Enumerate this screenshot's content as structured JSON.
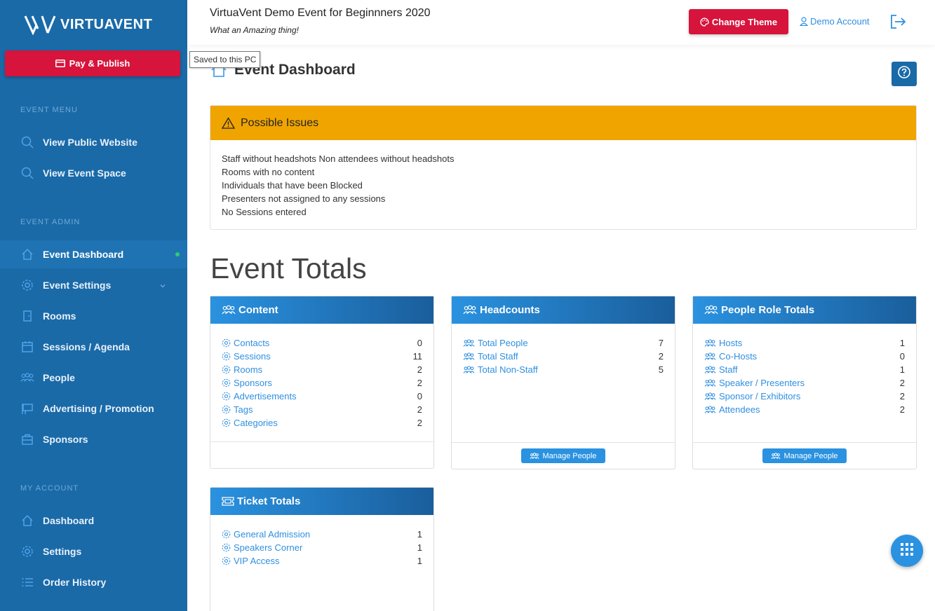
{
  "brand": {
    "name": "VIRTUAVENT"
  },
  "sidebar": {
    "pay_publish_label": "Pay & Publish",
    "sections": {
      "event_menu": "EVENT MENU",
      "event_admin": "EVENT ADMIN",
      "my_account": "MY ACCOUNT"
    },
    "event_menu_items": [
      {
        "label": "View Public Website",
        "icon": "search-icon"
      },
      {
        "label": "View Event Space",
        "icon": "search-icon"
      }
    ],
    "event_admin_items": [
      {
        "label": "Event Dashboard",
        "icon": "home-icon",
        "active": true
      },
      {
        "label": "Event Settings",
        "icon": "gear-icon"
      },
      {
        "label": "Rooms",
        "icon": "door-icon"
      },
      {
        "label": "Sessions / Agenda",
        "icon": "calendar-icon"
      },
      {
        "label": "People",
        "icon": "people-icon"
      },
      {
        "label": "Advertising / Promotion",
        "icon": "billboard-icon"
      },
      {
        "label": "Sponsors",
        "icon": "briefcase-icon"
      }
    ],
    "my_account_items": [
      {
        "label": "Dashboard",
        "icon": "home-icon"
      },
      {
        "label": "Settings",
        "icon": "gear-icon"
      },
      {
        "label": "Order History",
        "icon": "list-icon"
      }
    ]
  },
  "topbar": {
    "event_title": "VirtuaVent Demo Event for Beginnners 2020",
    "tagline": "What an Amazing thing!",
    "change_theme_label": "Change Theme",
    "account_label": "Demo Account"
  },
  "tooltip": {
    "text": "Saved to this PC"
  },
  "page": {
    "title": "Event Dashboard",
    "totals_title": "Event Totals"
  },
  "issues": {
    "title": "Possible Issues",
    "lines": [
      "Staff without headshots Non attendees without headshots",
      "Rooms with no content",
      "Individuals that have been Blocked",
      "Presenters not assigned to any sessions",
      "No Sessions entered"
    ]
  },
  "cards": {
    "content": {
      "title": "Content",
      "rows": [
        {
          "label": "Contacts",
          "value": "0"
        },
        {
          "label": "Sessions",
          "value": "11"
        },
        {
          "label": "Rooms",
          "value": "2"
        },
        {
          "label": "Sponsors",
          "value": "2"
        },
        {
          "label": "Advertisements",
          "value": "0"
        },
        {
          "label": "Tags",
          "value": "2"
        },
        {
          "label": "Categories",
          "value": "2"
        }
      ]
    },
    "headcounts": {
      "title": "Headcounts",
      "rows": [
        {
          "label": "Total People",
          "value": "7"
        },
        {
          "label": "Total Staff",
          "value": "2"
        },
        {
          "label": "Total Non-Staff",
          "value": "5"
        }
      ],
      "button": "Manage People"
    },
    "roles": {
      "title": "People Role Totals",
      "rows": [
        {
          "label": "Hosts",
          "value": "1"
        },
        {
          "label": "Co-Hosts",
          "value": "0"
        },
        {
          "label": "Staff",
          "value": "1"
        },
        {
          "label": "Speaker / Presenters",
          "value": "2"
        },
        {
          "label": "Sponsor / Exhibitors",
          "value": "2"
        },
        {
          "label": "Attendees",
          "value": "2"
        }
      ],
      "button": "Manage People"
    },
    "tickets": {
      "title": "Ticket Totals",
      "rows": [
        {
          "label": "General Admission",
          "value": "1"
        },
        {
          "label": "Speakers Corner",
          "value": "1"
        },
        {
          "label": "VIP Access",
          "value": "1"
        }
      ]
    }
  },
  "colors": {
    "sidebar": "#1a6aa8",
    "danger": "#d6143c",
    "warning": "#f0a400",
    "link": "#2f8fe0"
  }
}
